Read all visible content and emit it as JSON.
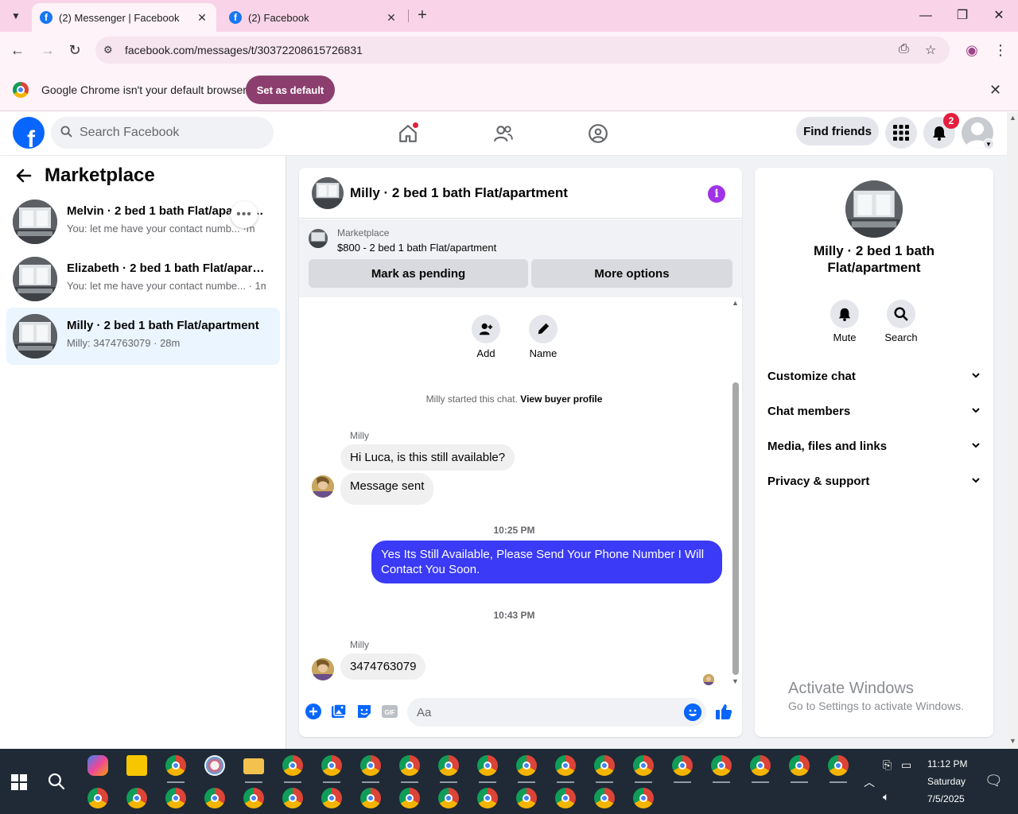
{
  "browser": {
    "tabs": [
      {
        "title": "(2) Messenger | Facebook",
        "active": true
      },
      {
        "title": "(2) Facebook",
        "active": false
      }
    ],
    "url": "facebook.com/messages/t/30372208615726831",
    "infobar_text": "Google Chrome isn't your default browser",
    "set_default_label": "Set as default"
  },
  "fb": {
    "search_placeholder": "Search Facebook",
    "find_friends": "Find friends",
    "notif_count": "2"
  },
  "left": {
    "title": "Marketplace",
    "conversations": [
      {
        "name": "Melvin · 2 bed 1 bath Flat/apartment",
        "snippet": "You: let me have your contact numb... ·m"
      },
      {
        "name": "Elizabeth · 2 bed 1 bath Flat/apart...",
        "snippet": "You: let me have your contact numbe... · 1m"
      },
      {
        "name": "Milly · 2 bed 1 bath Flat/apartment",
        "snippet": "Milly: 3474763079 · 28m"
      }
    ]
  },
  "chat": {
    "title": "Milly · 2 bed 1 bath Flat/apartment",
    "marketplace_label": "Marketplace",
    "listing": "$800 - 2 bed 1 bath Flat/apartment",
    "mark_pending": "Mark as pending",
    "more_options": "More options",
    "add_label": "Add",
    "name_label": "Name",
    "system_msg": "Milly started this chat.",
    "view_buyer": "View buyer profile",
    "sender": "Milly",
    "msg1": "Hi Luca, is this still available?",
    "msg2": "Message sent",
    "time1": "10:25 PM",
    "msg3": "Yes Its Still Available, Please Send Your Phone Number I Will Contact You Soon.",
    "time2": "10:43 PM",
    "sender2": "Milly",
    "msg4": "3474763079",
    "composer_placeholder": "Aa"
  },
  "info": {
    "name": "Milly · 2 bed 1 bath Flat/apartment",
    "mute": "Mute",
    "search": "Search",
    "sections": [
      "Customize chat",
      "Chat members",
      "Media, files and links",
      "Privacy & support"
    ]
  },
  "watermark": {
    "title": "Activate Windows",
    "sub": "Go to Settings to activate Windows."
  },
  "taskbar": {
    "time": "11:12 PM",
    "day": "Saturday",
    "date": "7/5/2025"
  },
  "colors": {
    "fb_blue": "#0866ff",
    "outgoing_bubble": "#3a3af7",
    "chrome_accent": "#8c3f6e",
    "tab_strip": "#f9d4e8"
  }
}
